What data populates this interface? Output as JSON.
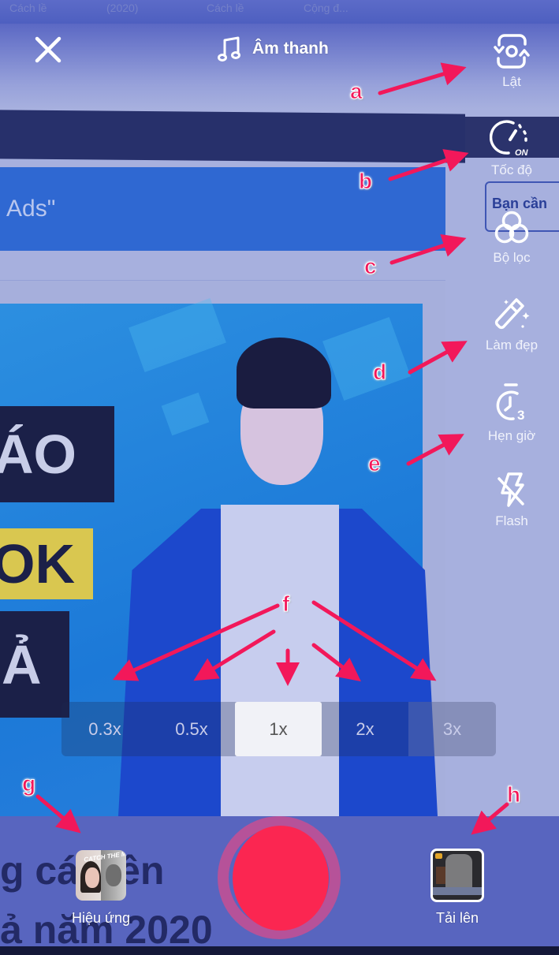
{
  "header": {
    "close_icon": "close-icon",
    "sound_icon": "music-note-icon",
    "sound_label": "Âm thanh"
  },
  "side_toolbar": {
    "items": [
      {
        "id": "flip",
        "icon": "flip-camera-icon",
        "label": "Lật"
      },
      {
        "id": "speed",
        "icon": "speed-gauge-icon",
        "label": "Tốc độ",
        "badge": "ON"
      },
      {
        "id": "filters",
        "icon": "filters-icon",
        "label": "Bộ lọc"
      },
      {
        "id": "beauty",
        "icon": "magic-wand-icon",
        "label": "Làm đẹp"
      },
      {
        "id": "timer",
        "icon": "timer-icon",
        "label": "Hẹn giờ",
        "badge": "3"
      },
      {
        "id": "flash",
        "icon": "flash-off-icon",
        "label": "Flash"
      }
    ]
  },
  "zoom_selector": {
    "options": [
      "0.3x",
      "0.5x",
      "1x",
      "2x",
      "3x"
    ],
    "selected": "1x"
  },
  "bottom_bar": {
    "effects_label": "Hiệu ứng",
    "effects_thumb_text": "CATCH THE MOMENT",
    "upload_label": "Tải lên",
    "record_color": "#fb2651"
  },
  "annotations": {
    "letters": [
      "a",
      "b",
      "c",
      "d",
      "e",
      "f",
      "g",
      "h"
    ],
    "color": "#f2185a"
  },
  "background_content": {
    "top_tabs": [
      "Cách lề",
      "(2020)",
      "Cách lề",
      "Cộng đ..."
    ],
    "banner_text": "Ads\"",
    "right_box_text": "Bạn cần",
    "label_lines": [
      "ÁO",
      "OK",
      "Ả"
    ],
    "bottom_lines": [
      "g cá trên",
      "ả năm 2020"
    ]
  }
}
